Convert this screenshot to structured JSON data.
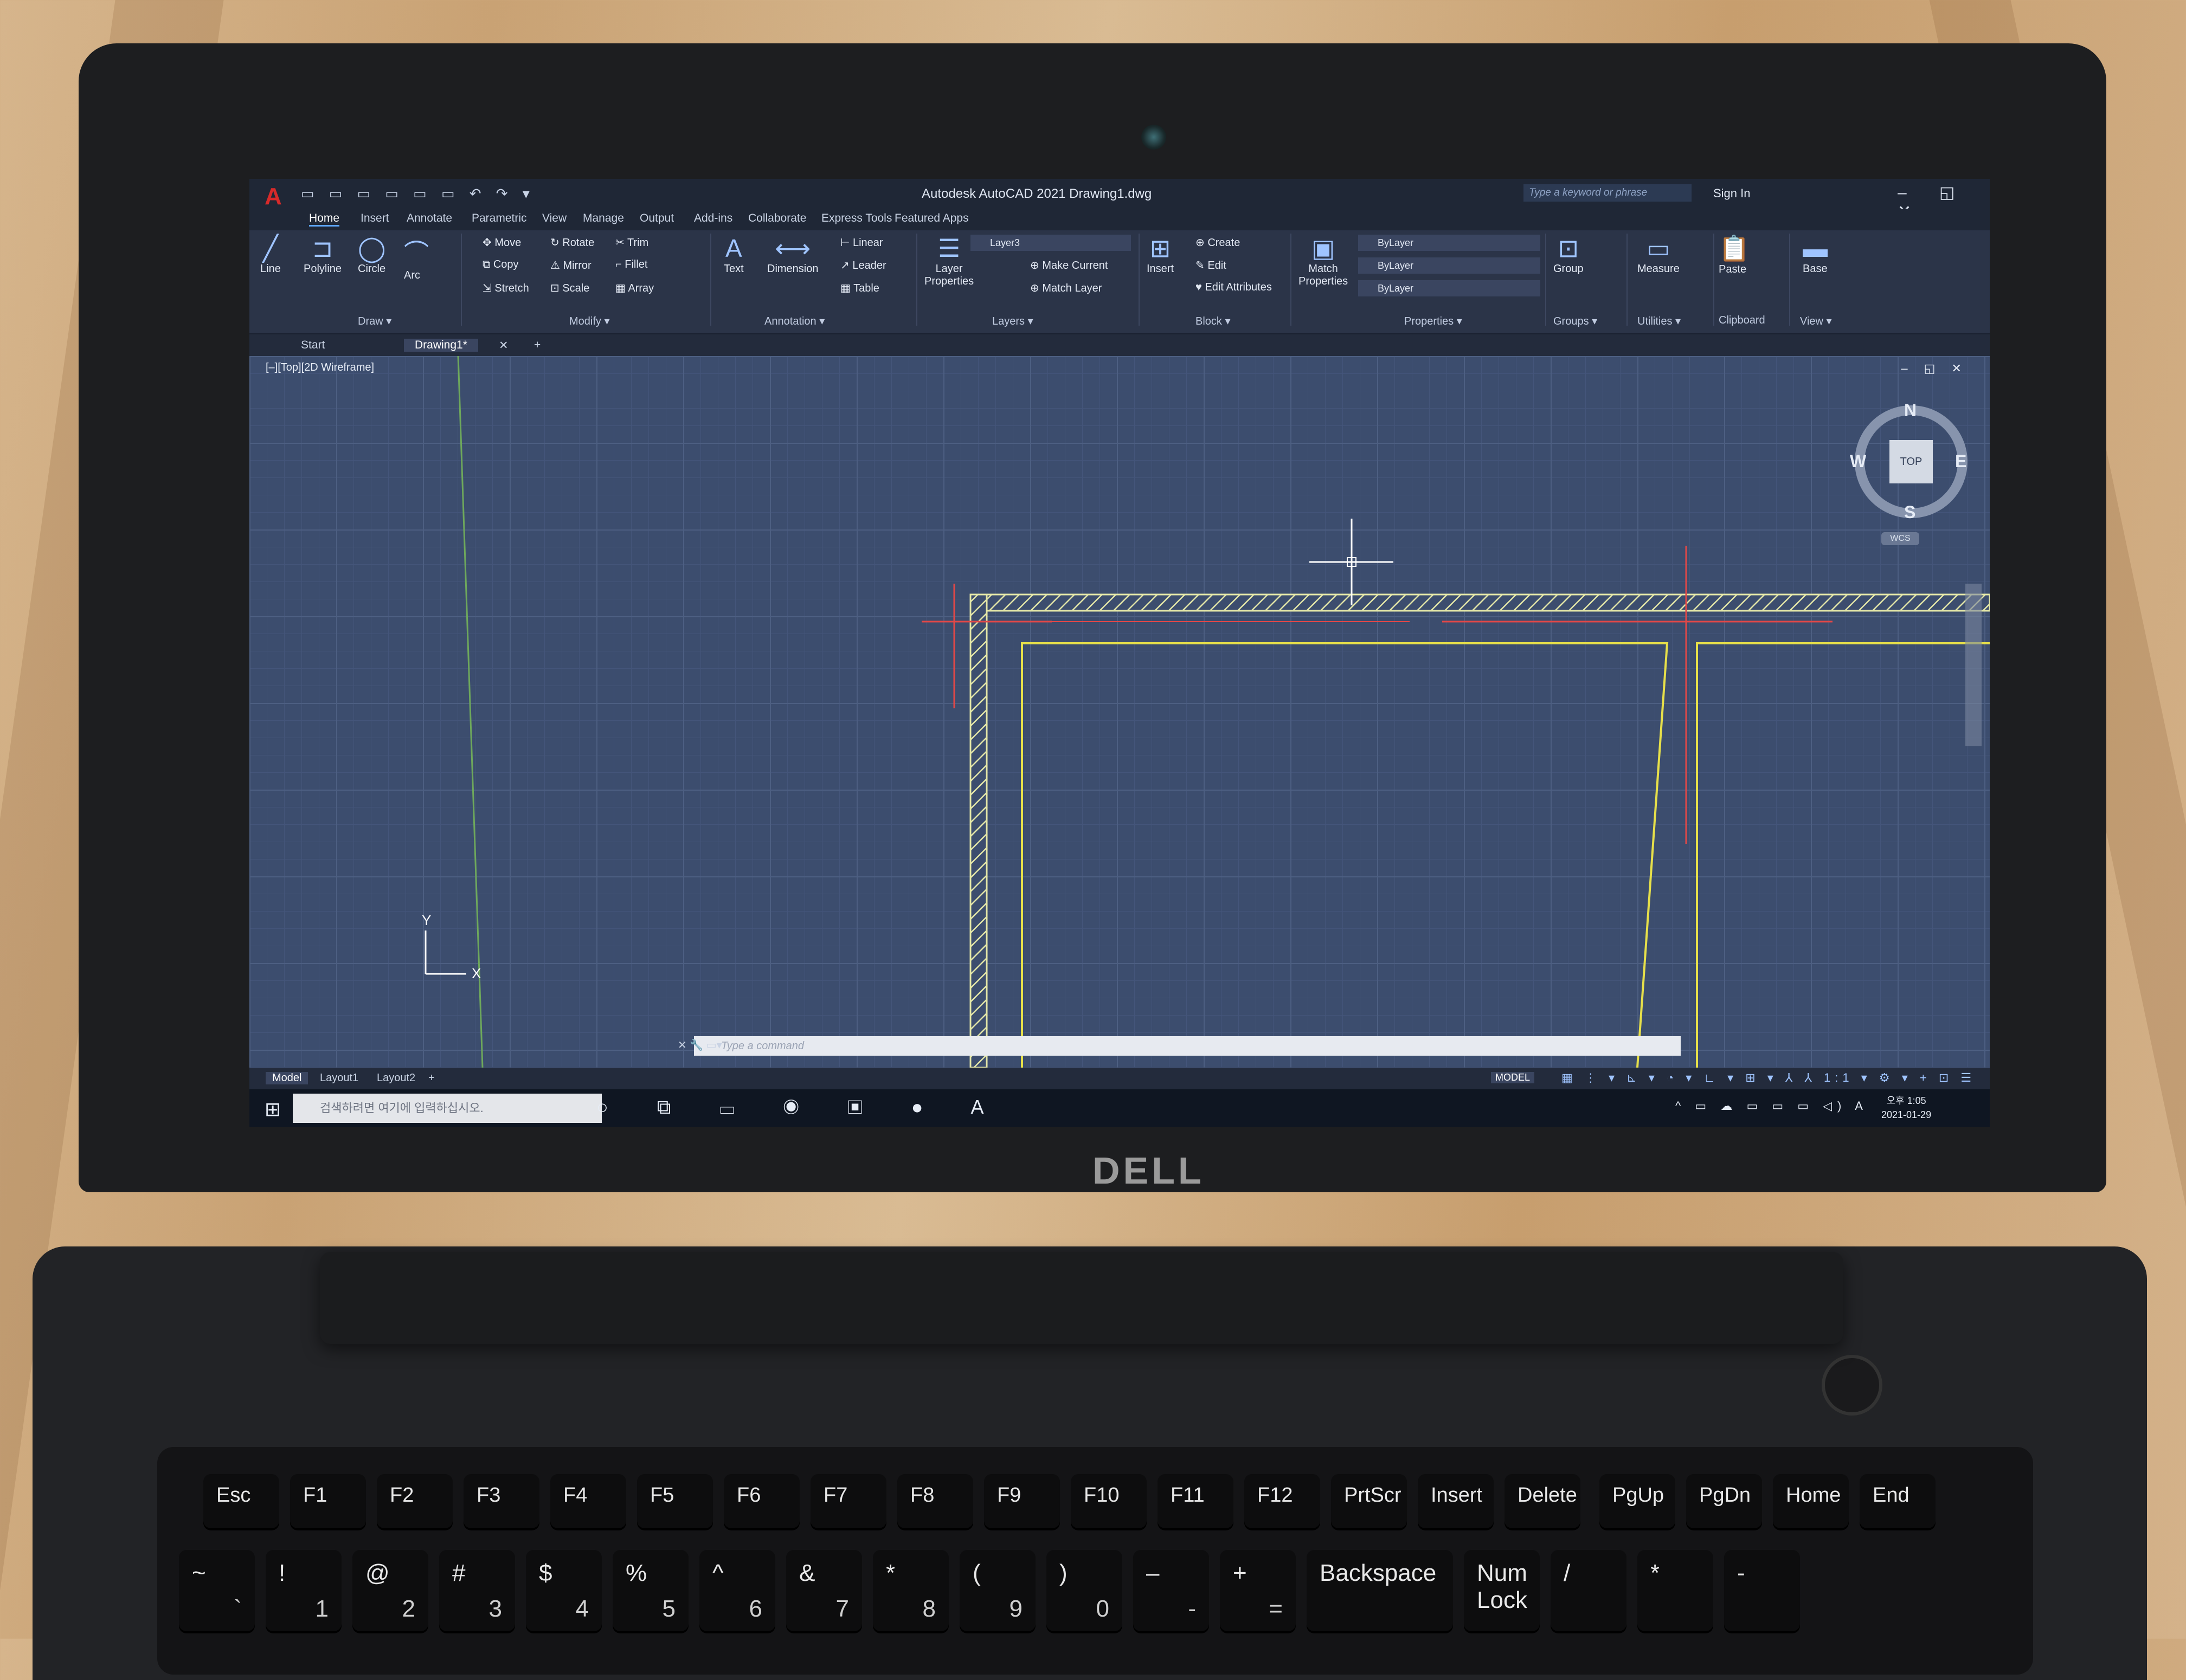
{
  "app": {
    "logo": "A",
    "title": "Autodesk AutoCAD 2021    Drawing1.dwg",
    "search_placeholder": "Type a keyword or phrase",
    "sign_in": "Sign In",
    "window_controls": "– ◱ ✕",
    "quick_access": "▭ ▭ ▭ ▭ ▭ ▭ ↶ ↷ ▾"
  },
  "ribbon_tabs": [
    "Home",
    "Insert",
    "Annotate",
    "Parametric",
    "View",
    "Manage",
    "Output",
    "Add-ins",
    "Collaborate",
    "Express Tools",
    "Featured Apps"
  ],
  "ribbon": {
    "draw": {
      "line": "Line",
      "polyline": "Polyline",
      "circle": "Circle",
      "arc": "Arc",
      "title": "Draw ▾"
    },
    "modify": {
      "move": "Move",
      "rotate": "Rotate",
      "trim": "Trim",
      "copy": "Copy",
      "mirror": "Mirror",
      "fillet": "Fillet",
      "stretch": "Stretch",
      "scale": "Scale",
      "array": "Array",
      "title": "Modify ▾"
    },
    "annotation": {
      "text": "Text",
      "dimension": "Dimension",
      "linear": "Linear",
      "leader": "Leader",
      "table": "Table",
      "title": "Annotation ▾"
    },
    "layers": {
      "layer_properties": "Layer\nProperties",
      "current_layer": "Layer3",
      "make_current": "Make Current",
      "match_layer": "Match Layer",
      "title": "Layers ▾"
    },
    "block": {
      "insert": "Insert",
      "create": "Create",
      "edit": "Edit",
      "edit_attributes": "Edit Attributes",
      "title": "Block ▾"
    },
    "properties": {
      "match_properties": "Match\nProperties",
      "color": "ByLayer",
      "linetype": "ByLayer",
      "lineweight": "ByLayer",
      "title": "Properties ▾"
    },
    "groups": {
      "group": "Group",
      "title": "Groups ▾"
    },
    "utilities": {
      "measure": "Measure",
      "title": "Utilities ▾"
    },
    "clipboard": {
      "paste": "Paste",
      "title": "Clipboard"
    },
    "view": {
      "base": "Base",
      "title": "View ▾"
    }
  },
  "doc_tabs": {
    "start": "Start",
    "drawing": "Drawing1*",
    "close": "✕",
    "new": "+"
  },
  "viewport": {
    "label": "[–][Top][2D Wireframe]",
    "controls": "– ◱ ✕",
    "viewcube": {
      "n": "N",
      "s": "S",
      "e": "E",
      "w": "W",
      "face": "TOP",
      "wcs": "WCS"
    },
    "ucs": {
      "x": "X",
      "y": "Y"
    }
  },
  "command_line": {
    "placeholder": "Type a command",
    "icons": "✕ 🔧 ▭▾"
  },
  "layout_tabs": [
    "Model",
    "Layout1",
    "Layout2",
    "+"
  ],
  "status_bar": {
    "model": "MODEL",
    "icons": "▦ ⋮ ▾ ⊾ ▾ ◔ ▾ ∟ ▾ ⊞ ▾ ⅄ ⅄ 1:1 ▾ ⚙ ▾ + ⊡ ☰"
  },
  "taskbar": {
    "start": "⊞",
    "search_placeholder": "검색하려면 여기에 입력하십시오.",
    "icons": "○ ⧉ ▭ ◉ ▣ ● A",
    "tray": "^ ▭ ☁ ▭ ▭ ▭ ◁) A",
    "time": "오후 1:05",
    "date": "2021-01-29"
  },
  "laptop": {
    "brand": "DELL"
  },
  "keyboard": {
    "row1": [
      "Esc",
      "F1",
      "F2",
      "F3",
      "F4",
      "F5",
      "F6",
      "F7",
      "F8",
      "F9",
      "F10",
      "F11",
      "F12",
      "PrtScr",
      "Insert",
      "Delete",
      "PgUp",
      "PgDn",
      "Home",
      "End"
    ],
    "row2": [
      {
        "top": "~",
        "bottom": "`"
      },
      {
        "top": "!",
        "bottom": "1"
      },
      {
        "top": "@",
        "bottom": "2"
      },
      {
        "top": "#",
        "bottom": "3"
      },
      {
        "top": "$",
        "bottom": "4"
      },
      {
        "top": "%",
        "bottom": "5"
      },
      {
        "top": "^",
        "bottom": "6"
      },
      {
        "top": "&",
        "bottom": "7"
      },
      {
        "top": "*",
        "bottom": "8"
      },
      {
        "top": "(",
        "bottom": "9"
      },
      {
        "top": ")",
        "bottom": "0"
      },
      {
        "top": "–",
        "bottom": "-"
      },
      {
        "top": "+",
        "bottom": "="
      },
      {
        "top": "Backspace",
        "bottom": ""
      },
      {
        "top": "Num\nLock",
        "bottom": ""
      },
      {
        "top": "/",
        "bottom": ""
      },
      {
        "top": "*",
        "bottom": ""
      },
      {
        "top": "-",
        "bottom": ""
      }
    ]
  },
  "colors": {
    "viewport_bg": "#3c4d6e",
    "hatch_wall": "#e5e8a8",
    "yellow_line": "#e7e04a",
    "red_line": "#e04848",
    "green_axis": "#6ea85c",
    "accent": "#5fa8ff"
  }
}
